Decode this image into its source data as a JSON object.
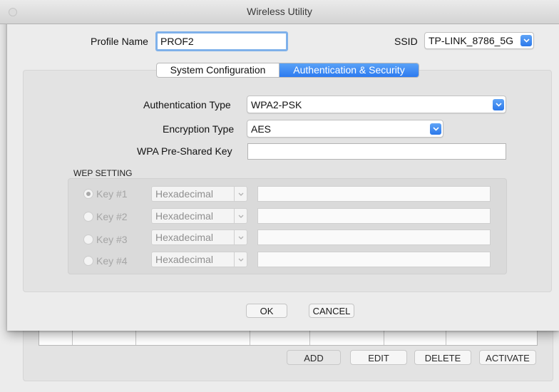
{
  "window": {
    "title": "Wireless Utility"
  },
  "profile": {
    "label": "Profile Name",
    "value": "PROF2"
  },
  "ssid": {
    "label": "SSID",
    "value": "TP-LINK_8786_5G"
  },
  "tabs": [
    {
      "label": "System Configuration",
      "selected": false
    },
    {
      "label": "Authentication & Security",
      "selected": true
    }
  ],
  "auth": {
    "auth_type_label": "Authentication Type",
    "auth_type_value": "WPA2-PSK",
    "encryption_label": "Encryption Type",
    "encryption_value": "AES",
    "psk_label": "WPA Pre-Shared Key",
    "psk_value": ""
  },
  "wep": {
    "section_label": "WEP SETTING",
    "keys": [
      {
        "label": "Key #1",
        "format": "Hexadecimal",
        "selected": true,
        "value": ""
      },
      {
        "label": "Key #2",
        "format": "Hexadecimal",
        "selected": false,
        "value": ""
      },
      {
        "label": "Key #3",
        "format": "Hexadecimal",
        "selected": false,
        "value": ""
      },
      {
        "label": "Key #4",
        "format": "Hexadecimal",
        "selected": false,
        "value": ""
      }
    ]
  },
  "dialog_buttons": {
    "ok": "OK",
    "cancel": "CANCEL"
  },
  "background_buttons": {
    "add": "ADD",
    "edit": "EDIT",
    "delete": "DELETE",
    "activate": "ACTIVATE"
  },
  "colors": {
    "accent": "#2c7af0",
    "focus_ring": "#7fb1ea"
  }
}
